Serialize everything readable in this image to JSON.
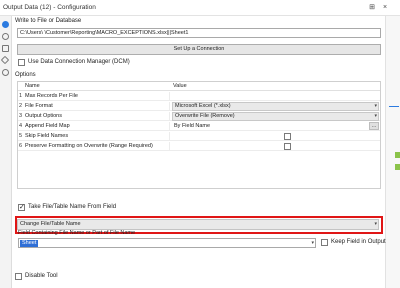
{
  "window": {
    "title": "Output Data (12) - Configuration",
    "pin_glyph": "⊞",
    "close_glyph": "×"
  },
  "sidebar": {
    "icons": [
      "config-icon",
      "tool-icon",
      "annotation-icon",
      "tag-icon",
      "help-icon"
    ]
  },
  "write_to": {
    "label": "Write to File or Database",
    "path": "C:\\Users\\              \\Customer\\Reporting\\MACRO_EXCEPTIONS.xlsx|||Sheet1",
    "setup_button": "Set Up a Connection",
    "dcm_label": "Use Data Connection Manager (DCM)",
    "dcm_checked": false
  },
  "options": {
    "label": "Options",
    "headers": {
      "name": "Name",
      "value": "Value"
    },
    "rows": [
      {
        "num": "1",
        "name": "Max Records Per File",
        "value": "",
        "kind": "text"
      },
      {
        "num": "2",
        "name": "File Format",
        "value": "Microsoft Excel (*.xlsx)",
        "kind": "dropdown"
      },
      {
        "num": "3",
        "name": "Output Options",
        "value": "Overwrite File (Remove)",
        "kind": "dropdown"
      },
      {
        "num": "4",
        "name": "Append Field Map",
        "value": "By Field Name",
        "kind": "ellipsis"
      },
      {
        "num": "5",
        "name": "Skip Field Names",
        "value": "",
        "kind": "checkbox"
      },
      {
        "num": "6",
        "name": "Preserve Formatting on Overwrite (Range Required)",
        "value": "",
        "kind": "checkbox"
      }
    ]
  },
  "take_name": {
    "label": "Take File/Table Name From Field",
    "checked": true,
    "dropdown_value": "Change File/Table Name",
    "field_label": "Field Containing File Name or Part of File Name",
    "field_value": "Sheet",
    "keep_label": "Keep Field in Output",
    "keep_checked": false
  },
  "disable_tool": {
    "label": "Disable Tool",
    "checked": false
  },
  "colors": {
    "highlight": "#e01616",
    "selection": "#2f6fd6",
    "accent_blue": "#2c7be0"
  }
}
